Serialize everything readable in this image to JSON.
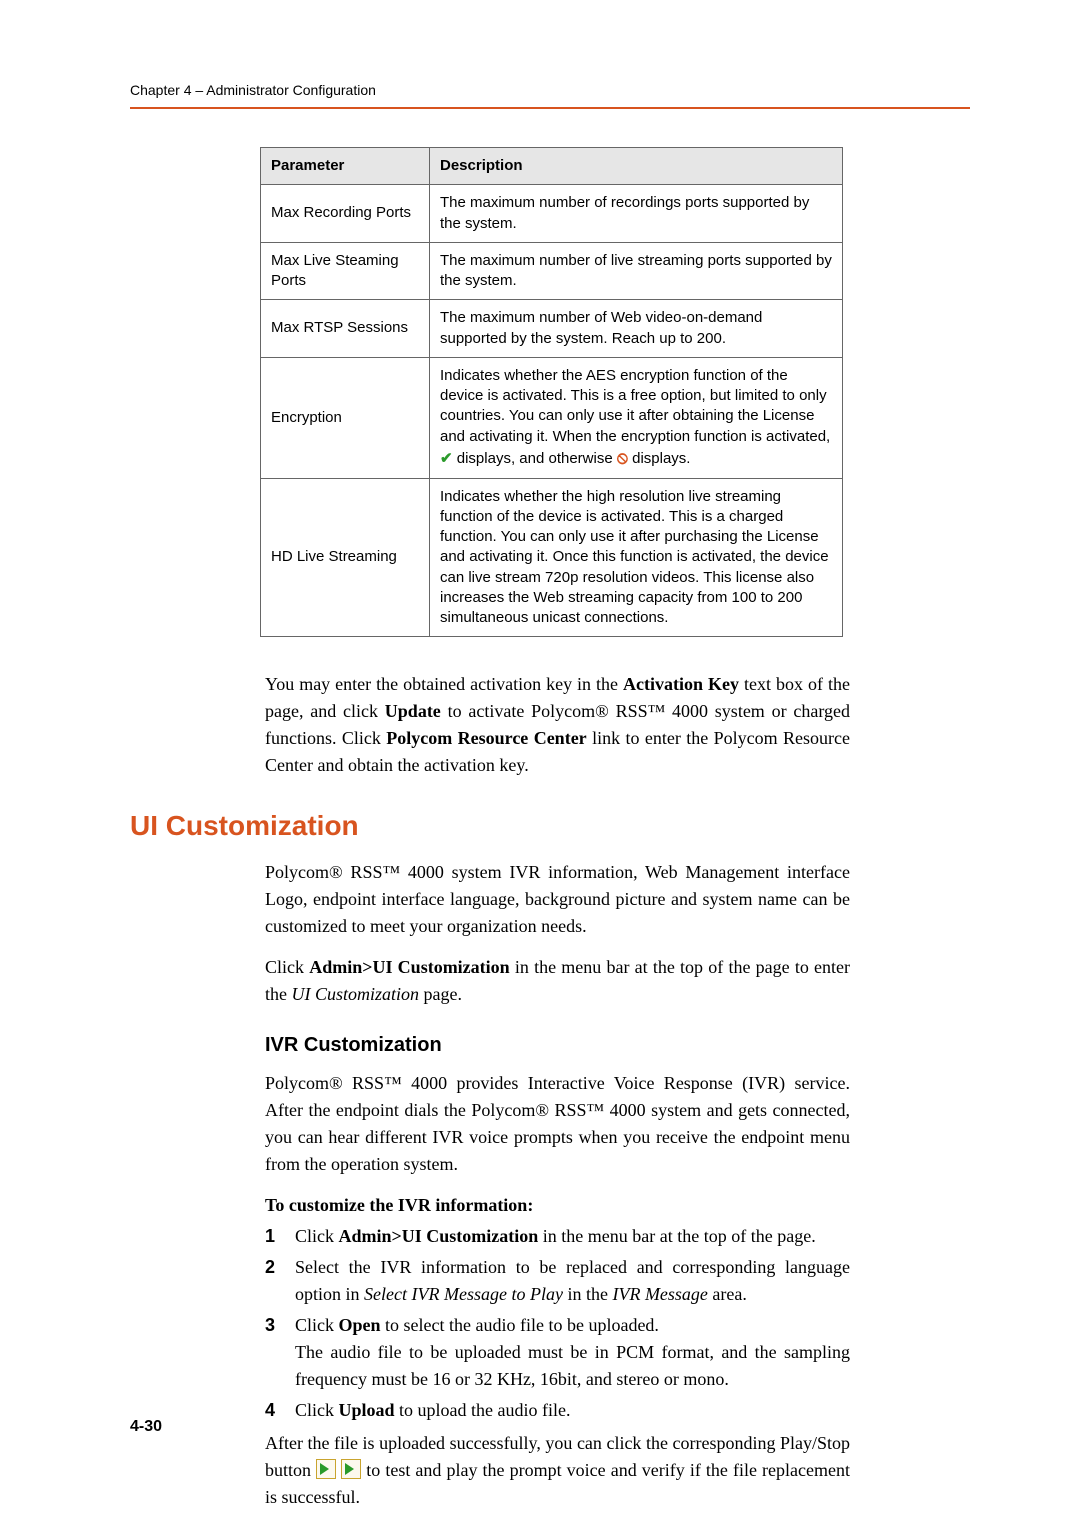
{
  "chapter_header": "Chapter 4 – Administrator Configuration",
  "table": {
    "head": {
      "param": "Parameter",
      "desc": "Description"
    },
    "rows": [
      {
        "param": "Max Recording Ports",
        "desc": "The maximum number of recordings ports supported by the system."
      },
      {
        "param": "Max Live Steaming Ports",
        "desc": "The maximum number of live streaming ports supported by the system."
      },
      {
        "param": "Max RTSP Sessions",
        "desc": "The maximum number of Web video-on-demand supported by the system. Reach up to 200."
      },
      {
        "param": "Encryption",
        "desc_pre": "Indicates whether the AES encryption function of the device is activated. This is a free option, but limited to only countries. You can only use it after obtaining the License and activating it. When the encryption function is activated,",
        "desc_mid1": " displays, and otherwise ",
        "desc_mid2": " displays."
      },
      {
        "param": "HD Live Streaming",
        "desc": "Indicates whether the high resolution live streaming function of the device is activated. This is a charged function. You can only use it after purchasing the License and activating it. Once this function is activated, the device can live stream 720p resolution videos. This license also increases the Web streaming capacity from 100 to 200 simultaneous unicast connections."
      }
    ]
  },
  "para1": {
    "p1": "You may enter the obtained activation key in the ",
    "b1": "Activation Key",
    "p2": " text box of the page, and click ",
    "b2": "Update",
    "p3": " to activate Polycom® RSS™ 4000 system or charged functions. Click ",
    "b3": "Polycom Resource Center",
    "p4": " link to enter the Polycom Resource Center and obtain the activation key."
  },
  "h1": "UI Customization",
  "para2": "Polycom® RSS™ 4000 system IVR information, Web Management interface Logo, endpoint interface language, background picture and system name can be customized to meet your organization needs.",
  "para3": {
    "p1": "Click ",
    "b1": "Admin>UI Customization",
    "p2": " in the menu bar at the top of the page to enter the ",
    "i1": "UI Customization",
    "p3": " page."
  },
  "h2": "IVR Customization",
  "para4": "Polycom® RSS™ 4000 provides Interactive Voice Response (IVR) service. After the endpoint dials the Polycom® RSS™ 4000 system and gets connected, you can hear different IVR voice prompts when you receive the endpoint menu from the operation system.",
  "steps_title": "To customize the IVR information:",
  "steps": {
    "n1": "1",
    "s1": {
      "p1": "Click ",
      "b1": "Admin>UI Customization",
      "p2": " in the menu bar at the top of the page."
    },
    "n2": "2",
    "s2": {
      "p1": "Select the IVR information to be replaced and corresponding language option in ",
      "i1": "Select IVR Message to Play",
      "p2": " in the ",
      "i2": "IVR Message",
      "p3": " area."
    },
    "n3": "3",
    "s3": {
      "p1": "Click ",
      "b1": "Open",
      "p2": " to select the audio file to be uploaded.",
      "p3": "The audio file to be uploaded must be in PCM format, and the sampling frequency must be 16 or 32 KHz, 16bit, and stereo or mono."
    },
    "n4": "4",
    "s4": {
      "p1": "Click ",
      "b1": "Upload",
      "p2": " to upload the audio file."
    }
  },
  "after": {
    "p1": "After the file is uploaded successfully, you can click the corresponding Play/Stop button ",
    "p2": " to test and play the prompt voice and verify if the file replacement is successful."
  },
  "page_number": "4-30"
}
